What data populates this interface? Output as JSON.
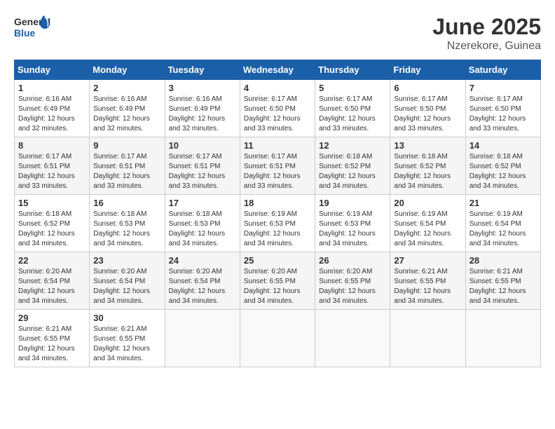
{
  "logo": {
    "general": "General",
    "blue": "Blue"
  },
  "header": {
    "title": "June 2025",
    "subtitle": "Nzerekore, Guinea"
  },
  "days_of_week": [
    "Sunday",
    "Monday",
    "Tuesday",
    "Wednesday",
    "Thursday",
    "Friday",
    "Saturday"
  ],
  "weeks": [
    [
      {
        "day": "1",
        "sunrise": "6:16 AM",
        "sunset": "6:49 PM",
        "daylight": "12 hours and 32 minutes."
      },
      {
        "day": "2",
        "sunrise": "6:16 AM",
        "sunset": "6:49 PM",
        "daylight": "12 hours and 32 minutes."
      },
      {
        "day": "3",
        "sunrise": "6:16 AM",
        "sunset": "6:49 PM",
        "daylight": "12 hours and 32 minutes."
      },
      {
        "day": "4",
        "sunrise": "6:17 AM",
        "sunset": "6:50 PM",
        "daylight": "12 hours and 33 minutes."
      },
      {
        "day": "5",
        "sunrise": "6:17 AM",
        "sunset": "6:50 PM",
        "daylight": "12 hours and 33 minutes."
      },
      {
        "day": "6",
        "sunrise": "6:17 AM",
        "sunset": "6:50 PM",
        "daylight": "12 hours and 33 minutes."
      },
      {
        "day": "7",
        "sunrise": "6:17 AM",
        "sunset": "6:50 PM",
        "daylight": "12 hours and 33 minutes."
      }
    ],
    [
      {
        "day": "8",
        "sunrise": "6:17 AM",
        "sunset": "6:51 PM",
        "daylight": "12 hours and 33 minutes."
      },
      {
        "day": "9",
        "sunrise": "6:17 AM",
        "sunset": "6:51 PM",
        "daylight": "12 hours and 33 minutes."
      },
      {
        "day": "10",
        "sunrise": "6:17 AM",
        "sunset": "6:51 PM",
        "daylight": "12 hours and 33 minutes."
      },
      {
        "day": "11",
        "sunrise": "6:17 AM",
        "sunset": "6:51 PM",
        "daylight": "12 hours and 33 minutes."
      },
      {
        "day": "12",
        "sunrise": "6:18 AM",
        "sunset": "6:52 PM",
        "daylight": "12 hours and 34 minutes."
      },
      {
        "day": "13",
        "sunrise": "6:18 AM",
        "sunset": "6:52 PM",
        "daylight": "12 hours and 34 minutes."
      },
      {
        "day": "14",
        "sunrise": "6:18 AM",
        "sunset": "6:52 PM",
        "daylight": "12 hours and 34 minutes."
      }
    ],
    [
      {
        "day": "15",
        "sunrise": "6:18 AM",
        "sunset": "6:52 PM",
        "daylight": "12 hours and 34 minutes."
      },
      {
        "day": "16",
        "sunrise": "6:18 AM",
        "sunset": "6:53 PM",
        "daylight": "12 hours and 34 minutes."
      },
      {
        "day": "17",
        "sunrise": "6:18 AM",
        "sunset": "6:53 PM",
        "daylight": "12 hours and 34 minutes."
      },
      {
        "day": "18",
        "sunrise": "6:19 AM",
        "sunset": "6:53 PM",
        "daylight": "12 hours and 34 minutes."
      },
      {
        "day": "19",
        "sunrise": "6:19 AM",
        "sunset": "6:53 PM",
        "daylight": "12 hours and 34 minutes."
      },
      {
        "day": "20",
        "sunrise": "6:19 AM",
        "sunset": "6:54 PM",
        "daylight": "12 hours and 34 minutes."
      },
      {
        "day": "21",
        "sunrise": "6:19 AM",
        "sunset": "6:54 PM",
        "daylight": "12 hours and 34 minutes."
      }
    ],
    [
      {
        "day": "22",
        "sunrise": "6:20 AM",
        "sunset": "6:54 PM",
        "daylight": "12 hours and 34 minutes."
      },
      {
        "day": "23",
        "sunrise": "6:20 AM",
        "sunset": "6:54 PM",
        "daylight": "12 hours and 34 minutes."
      },
      {
        "day": "24",
        "sunrise": "6:20 AM",
        "sunset": "6:54 PM",
        "daylight": "12 hours and 34 minutes."
      },
      {
        "day": "25",
        "sunrise": "6:20 AM",
        "sunset": "6:55 PM",
        "daylight": "12 hours and 34 minutes."
      },
      {
        "day": "26",
        "sunrise": "6:20 AM",
        "sunset": "6:55 PM",
        "daylight": "12 hours and 34 minutes."
      },
      {
        "day": "27",
        "sunrise": "6:21 AM",
        "sunset": "6:55 PM",
        "daylight": "12 hours and 34 minutes."
      },
      {
        "day": "28",
        "sunrise": "6:21 AM",
        "sunset": "6:55 PM",
        "daylight": "12 hours and 34 minutes."
      }
    ],
    [
      {
        "day": "29",
        "sunrise": "6:21 AM",
        "sunset": "6:55 PM",
        "daylight": "12 hours and 34 minutes."
      },
      {
        "day": "30",
        "sunrise": "6:21 AM",
        "sunset": "6:55 PM",
        "daylight": "12 hours and 34 minutes."
      },
      null,
      null,
      null,
      null,
      null
    ]
  ]
}
